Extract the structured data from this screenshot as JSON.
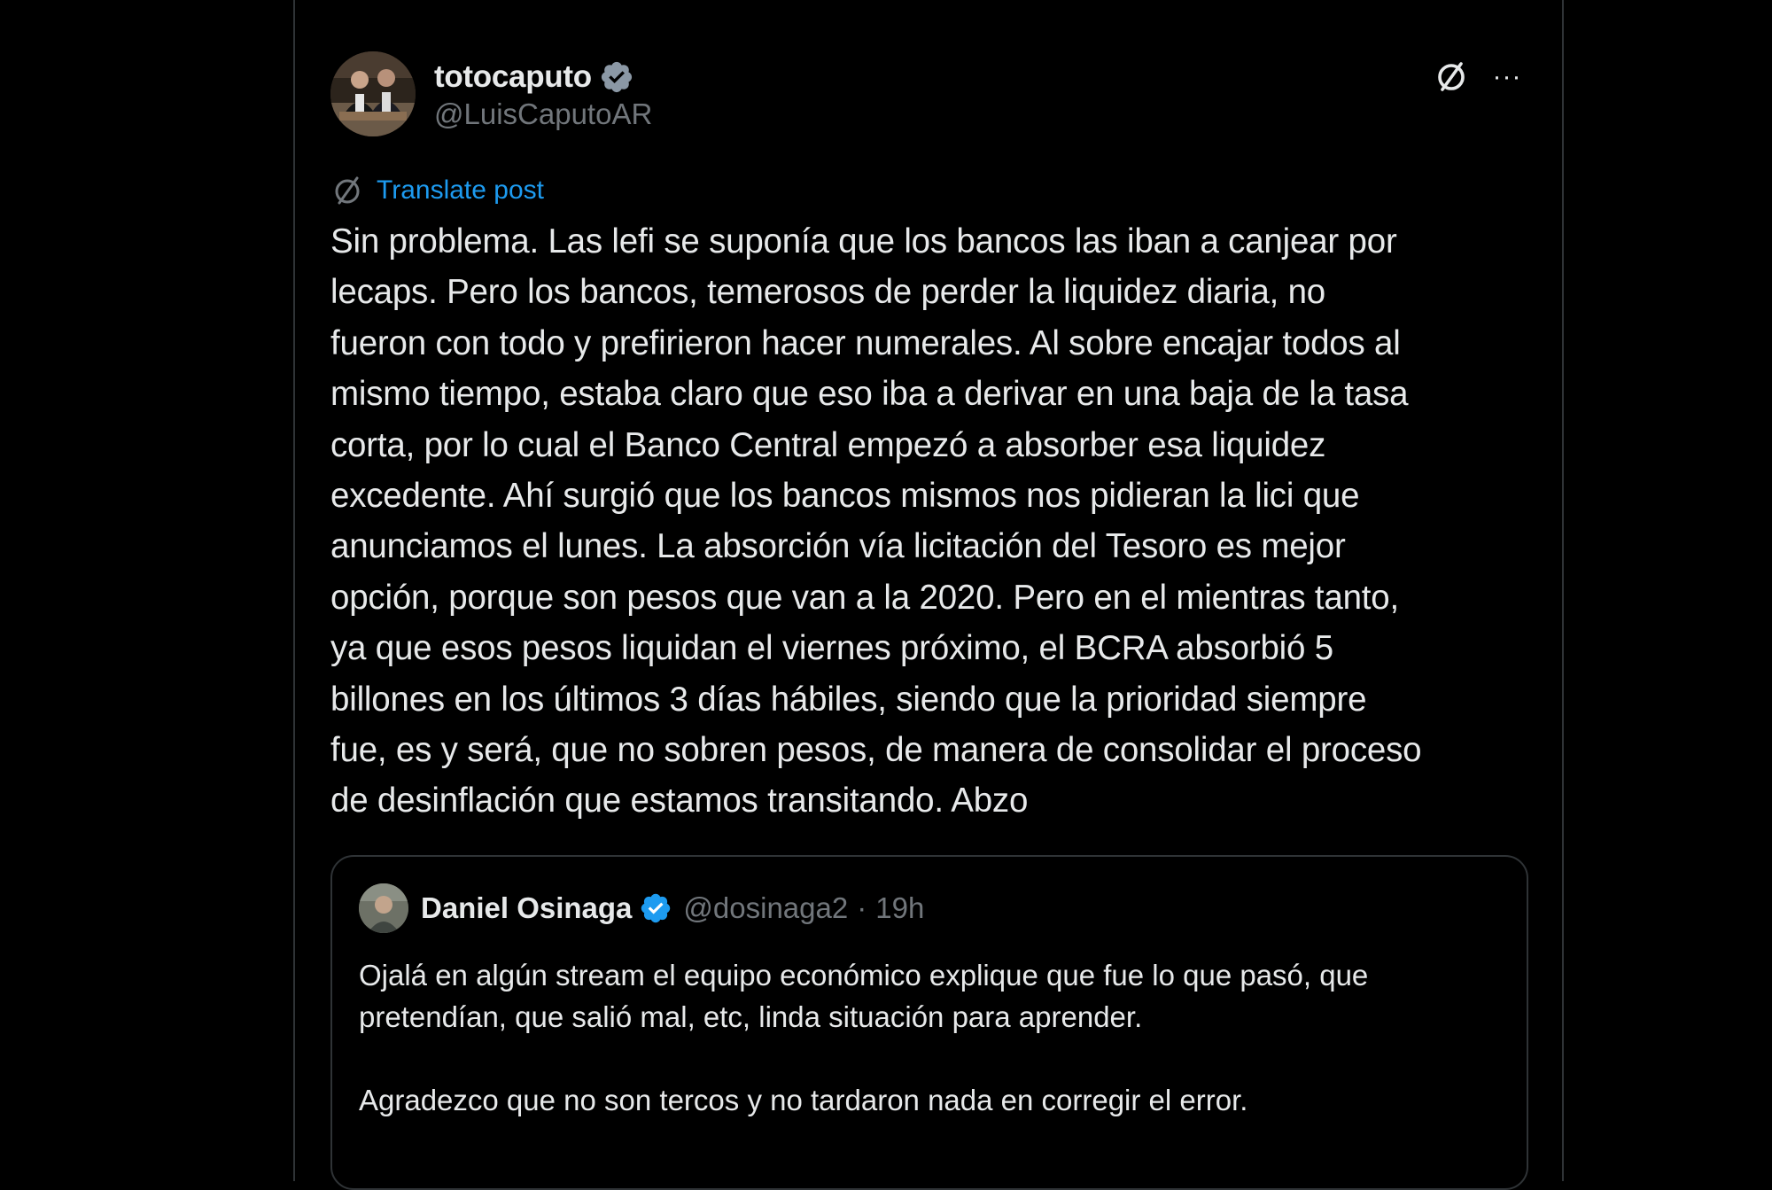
{
  "post": {
    "author_name": "totocaputo",
    "author_handle": "@LuisCaputoAR",
    "translate_label": "Translate post",
    "more_label": "···",
    "text": "Sin problema. Las lefi se suponía que los bancos las iban a canjear por\nlecaps. Pero los bancos, temerosos de perder la liquidez diaria, no\nfueron con todo y prefirieron hacer numerales. Al sobre encajar todos al\nmismo tiempo, estaba claro que eso iba a derivar en una baja de la tasa\ncorta, por lo cual el Banco Central  empezó a absorber esa liquidez\nexcedente. Ahí surgió que los bancos mismos nos pidieran la lici que\nanunciamos el lunes. La absorción vía licitación del Tesoro es mejor\nopción, porque son pesos que van a la 2020. Pero en el mientras tanto,\nya que esos pesos liquidan el viernes próximo, el BCRA absorbió 5\nbillones en los últimos 3 días hábiles, siendo que la prioridad siempre\nfue, es y será, que no sobren pesos, de manera de consolidar el proceso\nde desinflación que estamos transitando. Abzo"
  },
  "quote": {
    "author_name": "Daniel Osinaga",
    "author_handle": "@dosinaga2",
    "separator": "·",
    "time": "19h",
    "paragraph_1": "Ojalá en algún stream el equipo económico explique que fue lo que pasó, que pretendían, que salió mal, etc, linda situación para aprender.",
    "paragraph_2": "Agradezco que no son tercos y no tardaron nada en corregir el error."
  },
  "colors": {
    "background": "#000000",
    "text_primary": "#e7e9ea",
    "text_secondary": "#71767b",
    "accent_blue": "#1d9bf0",
    "border": "#2f3336",
    "verified_badge": "#1d9bf0"
  },
  "icons": {
    "verified": "verified-badge-icon",
    "grok": "grok-icon",
    "more": "more-dots-icon",
    "translate": "translate-icon"
  }
}
